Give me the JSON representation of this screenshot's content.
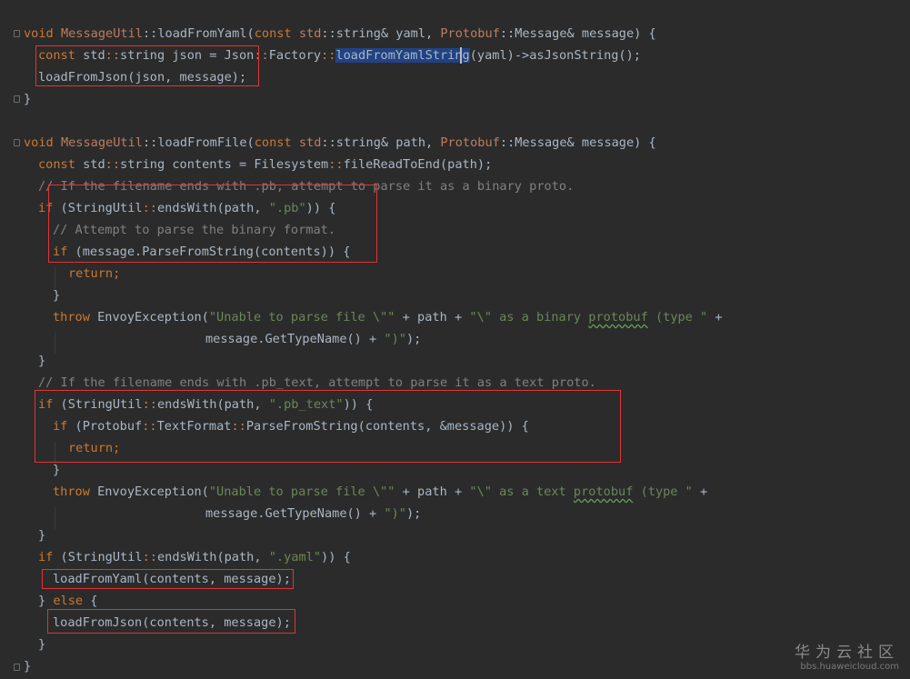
{
  "watermark": {
    "brand": "华为云社区",
    "url": "bbs.huaweicloud.com"
  },
  "code": {
    "l1": {
      "void": "void",
      "cls": "MessageUtil",
      "sep1": "::",
      "fn": "loadFromYaml(",
      "const": "const",
      "std": "std",
      "sep2": "::",
      "mid": "string& yaml, ",
      "proto": "Protobuf",
      "sep3": "::",
      "tail": "Message& message) {"
    },
    "l2": {
      "const": "const",
      "a": " std",
      "sep1": "::",
      "b": "string json = Json",
      "sep2": "::",
      "c": "Factory",
      "sep3": "::",
      "hl": "loadFromYamlString",
      "d": "(yaml)->asJsonString();"
    },
    "l3": {
      "text": "loadFromJson(json, message);"
    },
    "l4": {
      "text": "}"
    },
    "l5": {
      "void": "void",
      "cls": "MessageUtil",
      "sep1": "::",
      "fn": "loadFromFile(",
      "const": "const",
      "std": "std",
      "sep2": "::",
      "mid": "string& path, ",
      "proto": "Protobuf",
      "sep3": "::",
      "tail": "Message& message) {"
    },
    "l6": {
      "const": "const",
      "a": " std",
      "sep1": "::",
      "b": "string contents = Filesystem",
      "sep2": "::",
      "c": "fileReadToEnd(path);"
    },
    "l7": {
      "text": "// If the filename ends with .pb, attempt to parse it as a binary proto."
    },
    "l8": {
      "if": "if",
      "a": " (StringUtil",
      "sep": "::",
      "b": "endsWith(path, ",
      "str": "\".pb\"",
      "c": ")) {"
    },
    "l9": {
      "text": "// Attempt to parse the binary format."
    },
    "l10": {
      "if": "if",
      "a": " (message.ParseFromString(contents)) {"
    },
    "l11": {
      "text": "return;"
    },
    "l12": {
      "text": "}"
    },
    "l13": {
      "throw": "throw",
      "a": " EnvoyException(",
      "s1": "\"Unable to parse file \\\"\"",
      "b": " + path + ",
      "s2": "\"\\\" as a binary ",
      "s3": "protobuf",
      "s4": " (type \"",
      "c": " +"
    },
    "l14": {
      "a": "message.GetTypeName() + ",
      "s": "\")\"",
      "b": ");"
    },
    "l15": {
      "text": "}"
    },
    "l16": {
      "text": "// If the filename ends with .pb_text, attempt to parse it as a text proto."
    },
    "l17": {
      "if": "if",
      "a": " (StringUtil",
      "sep": "::",
      "b": "endsWith(path, ",
      "str": "\".pb_text\"",
      "c": ")) {"
    },
    "l18": {
      "if": "if",
      "a": " (Protobuf",
      "sep1": "::",
      "b": "TextFormat",
      "sep2": "::",
      "c": "ParseFromString(contents, &message)) {"
    },
    "l19": {
      "text": "return;"
    },
    "l20": {
      "text": "}"
    },
    "l21": {
      "throw": "throw",
      "a": " EnvoyException(",
      "s1": "\"Unable to parse file \\\"\"",
      "b": " + path + ",
      "s2": "\"\\\" as a text ",
      "s3": "protobuf",
      "s4": " (type \"",
      "c": " +"
    },
    "l22": {
      "a": "message.GetTypeName() + ",
      "s": "\")\"",
      "b": ");"
    },
    "l23": {
      "text": "}"
    },
    "l24": {
      "if": "if",
      "a": " (StringUtil",
      "sep": "::",
      "b": "endsWith(path, ",
      "str": "\".yaml\"",
      "c": ")) {"
    },
    "l25": {
      "text": "loadFromYaml(contents, message);"
    },
    "l26": {
      "a": "} ",
      "else": "else",
      "b": " {"
    },
    "l27": {
      "text": "loadFromJson(contents, message);"
    },
    "l28": {
      "text": "}"
    },
    "l29": {
      "text": "}"
    }
  }
}
